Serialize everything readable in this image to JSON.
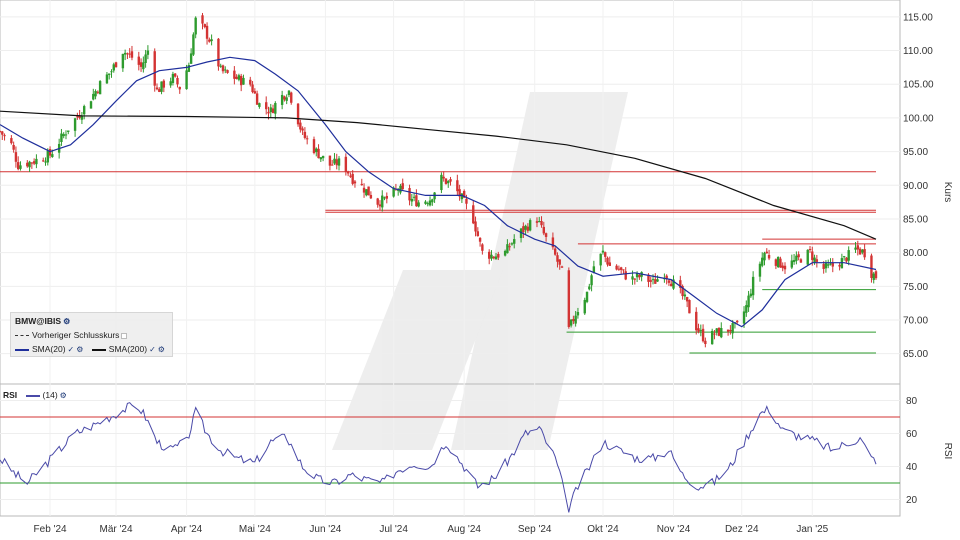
{
  "chart_data": [
    {
      "type": "candlestick",
      "title": "",
      "ylabel": "Kurs",
      "ylim": [
        60.5,
        117.5
      ],
      "yticks": [
        "115.00",
        "110.00",
        "105.00",
        "100.00",
        "95.00",
        "90.00",
        "85.00",
        "80.00",
        "75.00",
        "70.00",
        "65.00"
      ],
      "ytick_values": [
        115,
        110,
        105,
        100,
        95,
        90,
        85,
        80,
        75,
        70,
        65
      ],
      "x_ticks": [
        "Feb '24",
        "Mär '24",
        "Apr '24",
        "Mai '24",
        "Jun '24",
        "Jul '24",
        "Aug '24",
        "Sep '24",
        "Okt '24",
        "Nov '24",
        "Dez '24",
        "Jan '25"
      ],
      "x_tick_dates": [
        "2024-02-01",
        "2024-03-01",
        "2024-04-01",
        "2024-05-01",
        "2024-06-01",
        "2024-07-01",
        "2024-08-01",
        "2024-09-01",
        "2024-10-01",
        "2024-11-01",
        "2024-12-01",
        "2025-01-01"
      ],
      "date_range": [
        "2024-01-10",
        "2025-01-29"
      ],
      "close_path": [
        [
          "2024-01-10",
          98
        ],
        [
          "2024-01-15",
          96
        ],
        [
          "2024-01-18",
          93
        ],
        [
          "2024-01-24",
          93.5
        ],
        [
          "2024-02-01",
          94.5
        ],
        [
          "2024-02-06",
          97
        ],
        [
          "2024-02-10",
          99
        ],
        [
          "2024-02-15",
          101
        ],
        [
          "2024-02-20",
          103.5
        ],
        [
          "2024-02-24",
          105.5
        ],
        [
          "2024-02-28",
          107
        ],
        [
          "2024-03-04",
          110
        ],
        [
          "2024-03-08",
          109
        ],
        [
          "2024-03-12",
          107.5
        ],
        [
          "2024-03-15",
          110
        ],
        [
          "2024-03-19",
          104
        ],
        [
          "2024-03-22",
          105
        ],
        [
          "2024-03-26",
          106
        ],
        [
          "2024-03-29",
          104.5
        ],
        [
          "2024-04-02",
          108
        ],
        [
          "2024-04-05",
          114.5
        ],
        [
          "2024-04-09",
          113
        ],
        [
          "2024-04-12",
          111
        ],
        [
          "2024-04-16",
          107
        ],
        [
          "2024-04-22",
          106
        ],
        [
          "2024-04-29",
          105
        ],
        [
          "2024-05-03",
          102
        ],
        [
          "2024-05-08",
          101
        ],
        [
          "2024-05-12",
          103
        ],
        [
          "2024-05-16",
          104
        ],
        [
          "2024-05-22",
          97.5
        ],
        [
          "2024-05-28",
          95
        ],
        [
          "2024-06-03",
          93
        ],
        [
          "2024-06-08",
          93.5
        ],
        [
          "2024-06-13",
          91
        ],
        [
          "2024-06-18",
          89.5
        ],
        [
          "2024-06-24",
          87.5
        ],
        [
          "2024-06-28",
          88
        ],
        [
          "2024-07-03",
          89.5
        ],
        [
          "2024-07-08",
          88
        ],
        [
          "2024-07-12",
          87.5
        ],
        [
          "2024-07-17",
          88
        ],
        [
          "2024-07-22",
          91
        ],
        [
          "2024-07-27",
          90
        ],
        [
          "2024-07-31",
          88
        ],
        [
          "2024-08-05",
          85
        ],
        [
          "2024-08-09",
          80
        ],
        [
          "2024-08-14",
          79.5
        ],
        [
          "2024-08-19",
          80
        ],
        [
          "2024-08-24",
          82.5
        ],
        [
          "2024-08-29",
          84
        ],
        [
          "2024-09-02",
          85
        ],
        [
          "2024-09-06",
          82
        ],
        [
          "2024-09-10",
          79.5
        ],
        [
          "2024-09-13",
          77
        ],
        [
          "2024-09-16",
          68.5
        ],
        [
          "2024-09-19",
          71
        ],
        [
          "2024-09-24",
          74
        ],
        [
          "2024-09-27",
          78
        ],
        [
          "2024-10-01",
          80
        ],
        [
          "2024-10-04",
          78
        ],
        [
          "2024-10-08",
          77.5
        ],
        [
          "2024-10-13",
          76
        ],
        [
          "2024-10-18",
          76.5
        ],
        [
          "2024-10-23",
          75.5
        ],
        [
          "2024-10-28",
          77
        ],
        [
          "2024-11-02",
          75
        ],
        [
          "2024-11-06",
          73
        ],
        [
          "2024-11-11",
          69
        ],
        [
          "2024-11-15",
          67
        ],
        [
          "2024-11-19",
          68
        ],
        [
          "2024-11-24",
          68.5
        ],
        [
          "2024-11-29",
          69
        ],
        [
          "2024-12-03",
          72
        ],
        [
          "2024-12-07",
          77
        ],
        [
          "2024-12-11",
          80
        ],
        [
          "2024-12-15",
          79
        ],
        [
          "2024-12-20",
          78
        ],
        [
          "2024-12-26",
          79
        ],
        [
          "2024-12-31",
          80
        ],
        [
          "2025-01-05",
          77.5
        ],
        [
          "2025-01-10",
          78
        ],
        [
          "2025-01-15",
          79
        ],
        [
          "2025-01-20",
          80.5
        ],
        [
          "2025-01-24",
          80
        ],
        [
          "2025-01-27",
          77
        ],
        [
          "2025-01-29",
          76.5
        ]
      ],
      "series": [
        {
          "name": "SMA(20)",
          "color": "#1f2f9c",
          "points": [
            [
              "2024-01-10",
              99
            ],
            [
              "2024-01-20",
              97
            ],
            [
              "2024-02-01",
              95
            ],
            [
              "2024-02-10",
              96
            ],
            [
              "2024-02-20",
              99
            ],
            [
              "2024-03-01",
              102.5
            ],
            [
              "2024-03-10",
              105.5
            ],
            [
              "2024-03-20",
              107
            ],
            [
              "2024-04-01",
              107.5
            ],
            [
              "2024-04-10",
              108.3
            ],
            [
              "2024-04-20",
              109
            ],
            [
              "2024-05-01",
              108.5
            ],
            [
              "2024-05-10",
              106.5
            ],
            [
              "2024-05-20",
              104
            ],
            [
              "2024-06-01",
              99
            ],
            [
              "2024-06-10",
              95
            ],
            [
              "2024-06-20",
              92
            ],
            [
              "2024-07-01",
              89.5
            ],
            [
              "2024-07-15",
              88.5
            ],
            [
              "2024-07-31",
              88.5
            ],
            [
              "2024-08-10",
              87
            ],
            [
              "2024-08-20",
              84
            ],
            [
              "2024-09-01",
              82
            ],
            [
              "2024-09-10",
              81
            ],
            [
              "2024-09-20",
              78
            ],
            [
              "2024-10-01",
              76.5
            ],
            [
              "2024-10-15",
              77
            ],
            [
              "2024-10-31",
              76
            ],
            [
              "2024-11-10",
              73.5
            ],
            [
              "2024-11-20",
              71
            ],
            [
              "2024-12-01",
              69
            ],
            [
              "2024-12-10",
              71.5
            ],
            [
              "2024-12-20",
              76
            ],
            [
              "2025-01-01",
              78.5
            ],
            [
              "2025-01-15",
              78.5
            ],
            [
              "2025-01-29",
              77.5
            ]
          ]
        },
        {
          "name": "SMA(200)",
          "color": "#111111",
          "points": [
            [
              "2024-01-10",
              101
            ],
            [
              "2024-02-15",
              100.3
            ],
            [
              "2024-04-01",
              100.2
            ],
            [
              "2024-05-15",
              100
            ],
            [
              "2024-06-15",
              99.3
            ],
            [
              "2024-07-15",
              98.3
            ],
            [
              "2024-08-15",
              97.3
            ],
            [
              "2024-09-15",
              96
            ],
            [
              "2024-10-15",
              94
            ],
            [
              "2024-11-15",
              91
            ],
            [
              "2024-12-15",
              87
            ],
            [
              "2025-01-15",
              84
            ],
            [
              "2025-01-29",
              82
            ]
          ]
        }
      ],
      "hlines": [
        {
          "value": 92,
          "color": "#d33333",
          "from": "2024-01-10",
          "to": "2025-01-29"
        },
        {
          "value": 86.3,
          "color": "#d33333",
          "from": "2024-06-01",
          "to": "2025-01-29"
        },
        {
          "value": 86.0,
          "color": "#d33333",
          "from": "2024-06-01",
          "to": "2025-01-29"
        },
        {
          "value": 82.0,
          "color": "#d33333",
          "from": "2024-12-10",
          "to": "2025-01-29"
        },
        {
          "value": 81.3,
          "color": "#d33333",
          "from": "2024-09-20",
          "to": "2025-01-29"
        },
        {
          "value": 74.5,
          "color": "#2e9b2e",
          "from": "2024-12-10",
          "to": "2025-01-29"
        },
        {
          "value": 68.2,
          "color": "#2e9b2e",
          "from": "2024-09-15",
          "to": "2025-01-29"
        },
        {
          "value": 65.1,
          "color": "#2e9b2e",
          "from": "2024-11-08",
          "to": "2025-01-29"
        }
      ],
      "legend": {
        "title": "BMW@IBIS",
        "items": [
          "Vorheriger Schlusskurs",
          "SMA(20)",
          "SMA(200)"
        ]
      },
      "legend_position": "bottom-left",
      "grid": true
    },
    {
      "type": "line",
      "title": "",
      "ylabel": "RSI",
      "ylim": [
        10,
        90
      ],
      "yticks": [
        "80",
        "60",
        "40",
        "20"
      ],
      "ytick_values": [
        80,
        60,
        40,
        20
      ],
      "series": [
        {
          "name": "RSI (14)",
          "color": "#4a4aa8",
          "points": [
            [
              "2024-01-10",
              45
            ],
            [
              "2024-01-17",
              35
            ],
            [
              "2024-01-22",
              30
            ],
            [
              "2024-01-29",
              40
            ],
            [
              "2024-02-05",
              50
            ],
            [
              "2024-02-12",
              60
            ],
            [
              "2024-02-20",
              65
            ],
            [
              "2024-02-27",
              70
            ],
            [
              "2024-03-05",
              75
            ],
            [
              "2024-03-10",
              78
            ],
            [
              "2024-03-14",
              70
            ],
            [
              "2024-03-19",
              55
            ],
            [
              "2024-03-25",
              50
            ],
            [
              "2024-04-01",
              55
            ],
            [
              "2024-04-05",
              73
            ],
            [
              "2024-04-10",
              60
            ],
            [
              "2024-04-16",
              50
            ],
            [
              "2024-04-23",
              45
            ],
            [
              "2024-05-01",
              42
            ],
            [
              "2024-05-08",
              55
            ],
            [
              "2024-05-15",
              58
            ],
            [
              "2024-05-22",
              40
            ],
            [
              "2024-05-29",
              32
            ],
            [
              "2024-06-05",
              30
            ],
            [
              "2024-06-12",
              35
            ],
            [
              "2024-06-19",
              32
            ],
            [
              "2024-06-26",
              30
            ],
            [
              "2024-07-03",
              38
            ],
            [
              "2024-07-10",
              42
            ],
            [
              "2024-07-17",
              40
            ],
            [
              "2024-07-24",
              55
            ],
            [
              "2024-07-31",
              42
            ],
            [
              "2024-08-07",
              28
            ],
            [
              "2024-08-14",
              33
            ],
            [
              "2024-08-21",
              45
            ],
            [
              "2024-08-28",
              60
            ],
            [
              "2024-09-03",
              63
            ],
            [
              "2024-09-10",
              45
            ],
            [
              "2024-09-16",
              15
            ],
            [
              "2024-09-20",
              28
            ],
            [
              "2024-09-26",
              42
            ],
            [
              "2024-10-01",
              55
            ],
            [
              "2024-10-08",
              50
            ],
            [
              "2024-10-16",
              45
            ],
            [
              "2024-10-23",
              45
            ],
            [
              "2024-10-30",
              50
            ],
            [
              "2024-11-05",
              35
            ],
            [
              "2024-11-12",
              28
            ],
            [
              "2024-11-18",
              30
            ],
            [
              "2024-11-25",
              38
            ],
            [
              "2024-12-02",
              55
            ],
            [
              "2024-12-09",
              72
            ],
            [
              "2024-12-13",
              75
            ],
            [
              "2024-12-19",
              62
            ],
            [
              "2024-12-27",
              58
            ],
            [
              "2025-01-03",
              55
            ],
            [
              "2025-01-10",
              50
            ],
            [
              "2025-01-17",
              55
            ],
            [
              "2025-01-22",
              57
            ],
            [
              "2025-01-27",
              45
            ],
            [
              "2025-01-29",
              44
            ]
          ]
        }
      ],
      "hlines": [
        {
          "value": 70,
          "color": "#d33333"
        },
        {
          "value": 30,
          "color": "#2e9b2e"
        }
      ],
      "legend": {
        "title": "RSI",
        "items": [
          "(14)"
        ]
      },
      "legend_position": "top-left"
    }
  ]
}
